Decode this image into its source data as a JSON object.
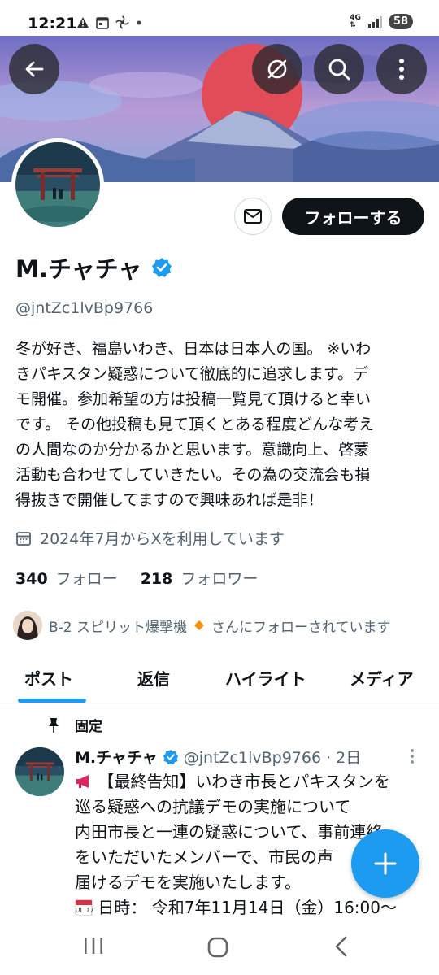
{
  "status_bar": {
    "time": "12:21",
    "network": "4G",
    "battery": "58"
  },
  "profile": {
    "name": "M.チャチャ",
    "handle": "@jntZc1lvBp9766",
    "bio_lines": [
      "冬が好き、福島いわき、日本は日本人の国。 ※いわ",
      "きパキスタン疑惑について徹底的に追求します。デ",
      "モ開催。参加希望の方は投稿一覧見て頂けると幸い",
      "です。 その他投稿も見て頂くとある程度どんな考え",
      "の人間なのか分かるかと思います。意識向上、啓蒙",
      "活動も合わせてしていきたい。その為の交流会も損",
      "得抜きで開催してますので興味あれば是非！"
    ],
    "joined": "2024年7月からXを利用しています",
    "following_count": "340",
    "following_label": "フォロー",
    "followers_count": "218",
    "followers_label": "フォロワー",
    "followed_by_name": "B-2 スピリット爆撃機",
    "followed_by_suffix": "さんにフォローされています"
  },
  "actions": {
    "follow_label": "フォローする"
  },
  "tabs": [
    {
      "label": "ポスト",
      "active": true
    },
    {
      "label": "返信",
      "active": false
    },
    {
      "label": "ハイライト",
      "active": false
    },
    {
      "label": "メディア",
      "active": false
    }
  ],
  "pinned_post": {
    "pinned_label": "固定",
    "author": "M.チャチャ",
    "meta": "@jntZc1lvBp9766 · 2日",
    "lines": [
      "【最終告知】いわき市長とパキスタンを",
      "巡る疑惑への抗議デモの実施について",
      "内田市長と一連の疑惑について、事前連絡",
      "をいただいたメンバーで、市民の声",
      "届けるデモを実施いたします。",
      "日時： 令和7年11月14日（金）16:00～"
    ],
    "calendar_icon_text": "JUL 17"
  },
  "colors": {
    "accent": "#1d9bf0",
    "text": "#0f1419",
    "muted": "#536471"
  },
  "icons": [
    "back-arrow-icon",
    "notifications-off-icon",
    "search-icon",
    "more-icon",
    "mail-icon",
    "verified-badge-icon",
    "calendar-icon",
    "pin-icon",
    "megaphone-icon",
    "calendar-emoji-icon",
    "compose-plus-icon"
  ]
}
